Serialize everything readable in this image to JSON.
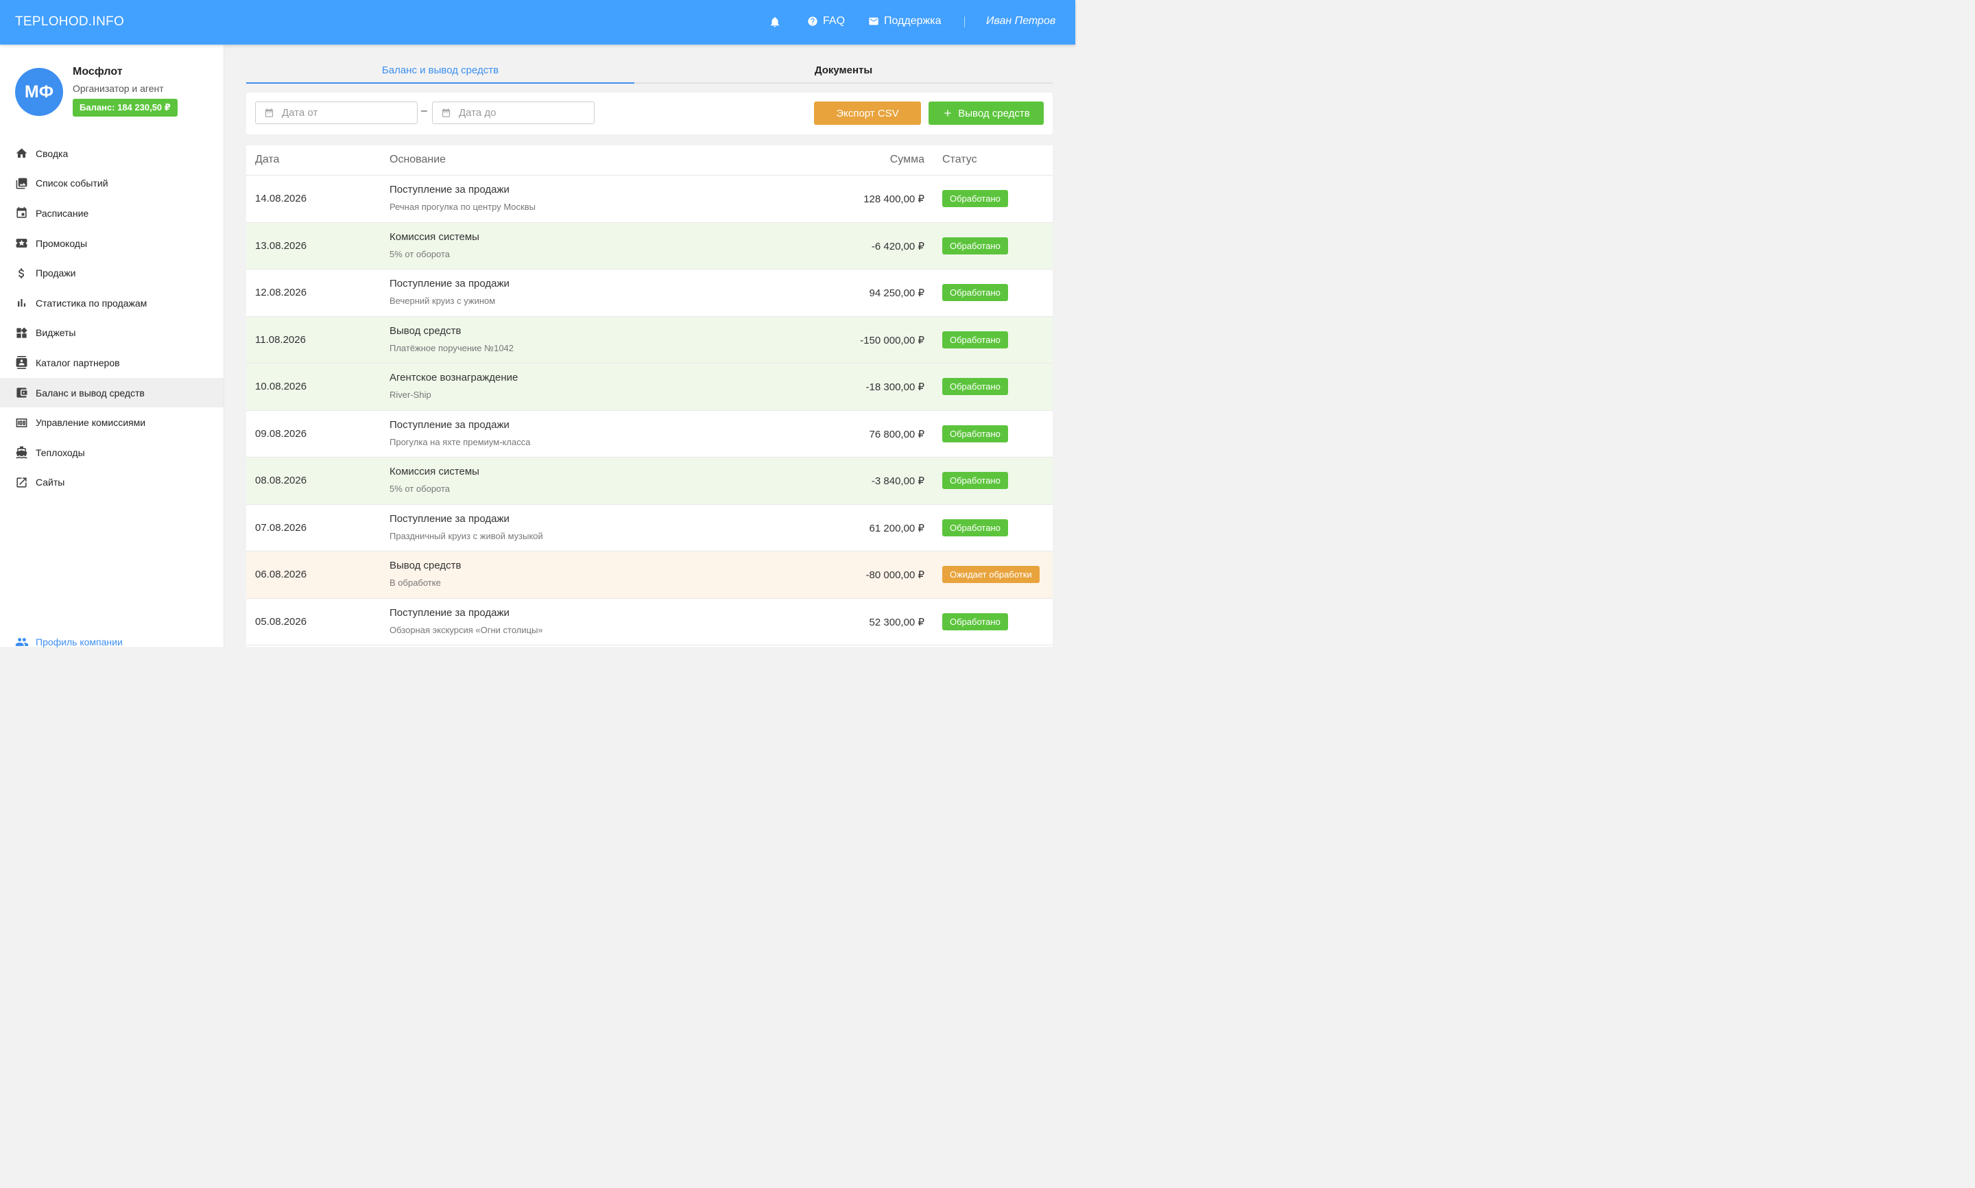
{
  "header": {
    "logo": "TEPLOHOD.INFO",
    "faq": "FAQ",
    "support": "Поддержка",
    "user": "Иван Петров"
  },
  "org": {
    "initials": "МФ",
    "name": "Мосфлот",
    "role": "Организатор и агент",
    "balance": "Баланс: 184 230,50 ₽"
  },
  "nav": [
    {
      "label": "Сводка",
      "icon": "home-icon"
    },
    {
      "label": "Список событий",
      "icon": "photo-library-icon"
    },
    {
      "label": "Расписание",
      "icon": "calendar-icon"
    },
    {
      "label": "Промокоды",
      "icon": "ticket-icon"
    },
    {
      "label": "Продажи",
      "icon": "dollar-icon"
    },
    {
      "label": "Статистика по продажам",
      "icon": "bar-chart-icon"
    },
    {
      "label": "Виджеты",
      "icon": "widgets-icon"
    },
    {
      "label": "Каталог партнеров",
      "icon": "contacts-icon"
    },
    {
      "label": "Баланс и вывод средств",
      "icon": "wallet-icon"
    },
    {
      "label": "Управление комиссиями",
      "icon": "money-icon"
    },
    {
      "label": "Теплоходы",
      "icon": "ship-icon"
    },
    {
      "label": "Сайты",
      "icon": "external-link-icon"
    }
  ],
  "nav_active": 8,
  "nav_bottom": "Профиль компании",
  "tabs": {
    "balance": "Баланс и вывод средств",
    "documents": "Документы"
  },
  "filters": {
    "date_from_placeholder": "Дата от",
    "date_to_placeholder": "Дата до",
    "dash": "–",
    "export_label": "Экспорт CSV",
    "withdraw_label": "Вывод средств"
  },
  "table": {
    "headers": {
      "date": "Дата",
      "basis": "Основание",
      "sum": "Сумма",
      "status": "Статус"
    },
    "rows": [
      {
        "date": "14.08.2026",
        "title": "Поступление за продажи",
        "sub": "Речная прогулка по центру Москвы",
        "sum": "128 400,00 ₽",
        "status": "Обработано",
        "kind": "in",
        "state": "ok"
      },
      {
        "date": "13.08.2026",
        "title": "Комиссия системы",
        "sub": "5% от оборота",
        "sum": "-6 420,00 ₽",
        "status": "Обработано",
        "kind": "out",
        "state": "ok"
      },
      {
        "date": "12.08.2026",
        "title": "Поступление за продажи",
        "sub": "Вечерний круиз с ужином",
        "sum": "94 250,00 ₽",
        "status": "Обработано",
        "kind": "in",
        "state": "ok"
      },
      {
        "date": "11.08.2026",
        "title": "Вывод средств",
        "sub": "Платёжное поручение №1042",
        "sum": "-150 000,00 ₽",
        "status": "Обработано",
        "kind": "out",
        "state": "ok"
      },
      {
        "date": "10.08.2026",
        "title": "Агентское вознаграждение",
        "sub": "River-Ship",
        "sum": "-18 300,00 ₽",
        "status": "Обработано",
        "kind": "out",
        "state": "ok"
      },
      {
        "date": "09.08.2026",
        "title": "Поступление за продажи",
        "sub": "Прогулка на яхте премиум-класса",
        "sum": "76 800,00 ₽",
        "status": "Обработано",
        "kind": "in",
        "state": "ok"
      },
      {
        "date": "08.08.2026",
        "title": "Комиссия системы",
        "sub": "5% от оборота",
        "sum": "-3 840,00 ₽",
        "status": "Обработано",
        "kind": "out",
        "state": "ok"
      },
      {
        "date": "07.08.2026",
        "title": "Поступление за продажи",
        "sub": "Праздничный круиз с живой музыкой",
        "sum": "61 200,00 ₽",
        "status": "Обработано",
        "kind": "in",
        "state": "ok"
      },
      {
        "date": "06.08.2026",
        "title": "Вывод средств",
        "sub": "В обработке",
        "sum": "-80 000,00 ₽",
        "status": "Ожидает обработки",
        "kind": "pending",
        "state": "wait"
      },
      {
        "date": "05.08.2026",
        "title": "Поступление за продажи",
        "sub": "Обзорная экскурсия «Огни столицы»",
        "sum": "52 300,00 ₽",
        "status": "Обработано",
        "kind": "in",
        "state": "ok"
      }
    ]
  },
  "colors": {
    "header": "#42a0ff",
    "accent": "#3d8ff0",
    "success": "#5cc43c",
    "warning": "#e8a33c",
    "row_out": "#f0f8ea",
    "row_pending": "#fdf4ea"
  }
}
